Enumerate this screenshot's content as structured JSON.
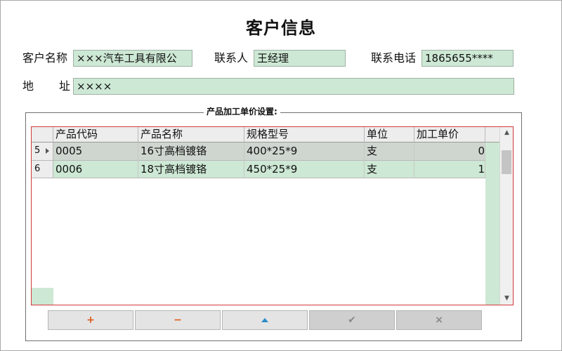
{
  "window": {
    "title": "客户信息"
  },
  "customer": {
    "name_label": "客户名称",
    "name_value": "×××汽车工具有限公",
    "contact_label": "联系人",
    "contact_value": "王经理",
    "phone_label": "联系电话",
    "phone_value": "1865655****",
    "address_label_1": "地",
    "address_label_2": "址",
    "address_value": "××××"
  },
  "group": {
    "legend": "产品加工单价设置:"
  },
  "grid": {
    "headers": [
      "产品代码",
      "产品名称",
      "规格型号",
      "单位",
      "加工单价"
    ],
    "rows": [
      {
        "index": "5",
        "code": "0005",
        "name": "16寸高档镀铬",
        "spec": "400*25*9",
        "unit": "支",
        "price": "0",
        "selected": true
      },
      {
        "index": "6",
        "code": "0006",
        "name": "18寸高档镀铬",
        "spec": "450*25*9",
        "unit": "支",
        "price": "1",
        "selected": false
      }
    ]
  },
  "icons": {
    "add": "+",
    "remove": "−",
    "move_up": "up-triangle",
    "confirm": "✔",
    "cancel": "×",
    "scroll_up": "▲",
    "scroll_down": "▼"
  },
  "colors": {
    "field_bg": "#cde8d4",
    "grid_border": "#d33a3a",
    "accent_orange": "#e05a1a",
    "accent_blue": "#2a8cc8"
  }
}
